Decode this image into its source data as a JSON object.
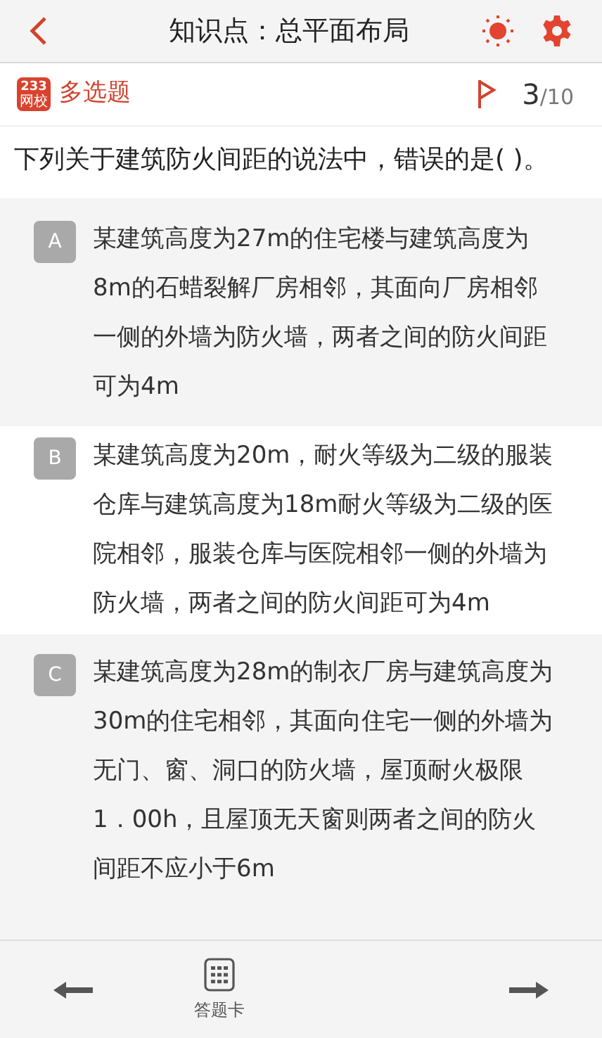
{
  "header": {
    "title": "知识点：总平面布局"
  },
  "question_bar": {
    "logo_text": [
      "233",
      "网校"
    ],
    "type": "多选题",
    "current": "3",
    "total": "/10"
  },
  "question": "下列关于建筑防火间距的说法中，错误的是(  )。",
  "options": [
    {
      "letter": "A",
      "text": "某建筑高度为27m的住宅楼与建筑高度为8m的石蜡裂解厂房相邻，其面向厂房相邻一侧的外墙为防火墙，两者之间的防火间距可为4m"
    },
    {
      "letter": "B",
      "text": "某建筑高度为20m，耐火等级为二级的服装仓库与建筑高度为18m耐火等级为二级的医院相邻，服装仓库与医院相邻一侧的外墙为防火墙，两者之间的防火间距可为4m"
    },
    {
      "letter": "C",
      "text": "某建筑高度为28m的制衣厂房与建筑高度为30m的住宅相邻，其面向住宅一侧的外墙为无门、窗、洞口的防火墙，屋顶耐火极限1．00h，且屋顶无天窗则两者之间的防火间距不应小于6m"
    }
  ],
  "bottom_bar": {
    "card_label": "答题卡"
  }
}
